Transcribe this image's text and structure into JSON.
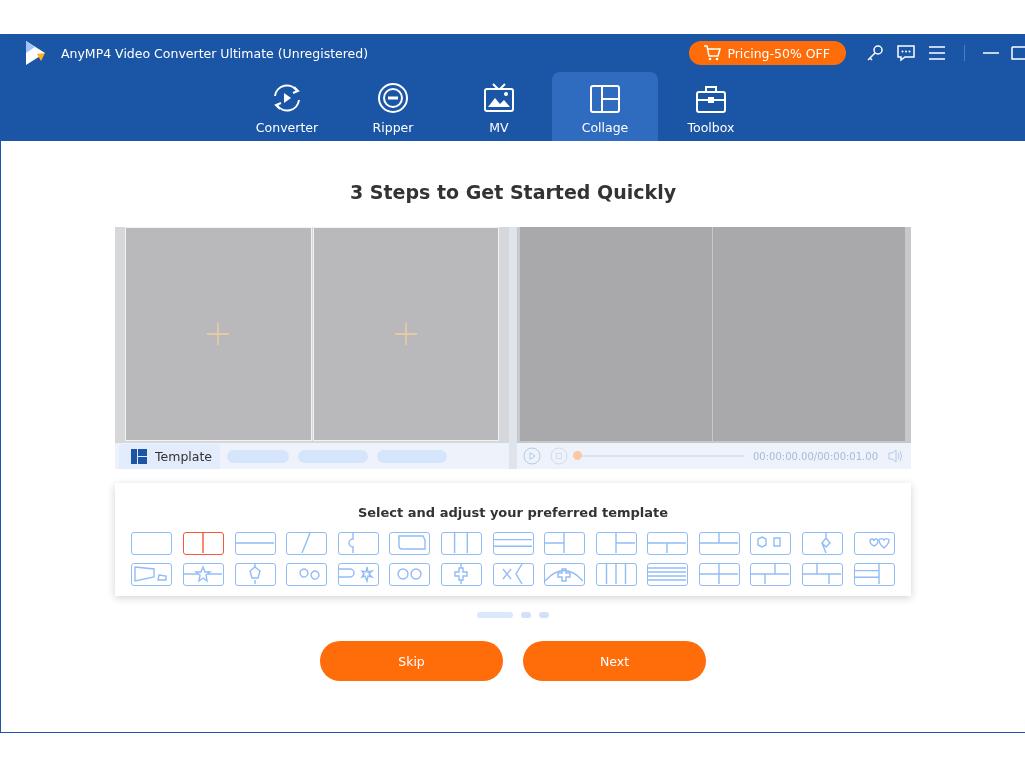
{
  "window": {
    "title": "AnyMP4 Video Converter Ultimate (Unregistered)"
  },
  "promo": {
    "label": "Pricing-50% OFF"
  },
  "tabs": [
    {
      "label": "Converter",
      "kind": "converter",
      "selected": false
    },
    {
      "label": "Ripper",
      "kind": "ripper",
      "selected": false
    },
    {
      "label": "MV",
      "kind": "mv",
      "selected": false
    },
    {
      "label": "Collage",
      "kind": "collage",
      "selected": true
    },
    {
      "label": "Toolbox",
      "kind": "toolbox",
      "selected": false
    }
  ],
  "heading": "3 Steps to Get Started Quickly",
  "preview": {
    "template_tab": {
      "label": "Template"
    },
    "progress": {
      "level": 0
    },
    "time": "00:00:00.00/00:00:01.00"
  },
  "template_panel": {
    "title": "Select and adjust your preferred template",
    "templates": [
      {
        "selected": false
      },
      {
        "selected": true
      },
      {
        "selected": false
      },
      {
        "selected": false
      },
      {
        "selected": false
      },
      {
        "selected": false
      },
      {
        "selected": false
      },
      {
        "selected": false
      },
      {
        "selected": false
      },
      {
        "selected": false
      },
      {
        "selected": false
      },
      {
        "selected": false
      },
      {
        "selected": false
      },
      {
        "selected": false
      },
      {
        "selected": false
      },
      {
        "selected": false
      },
      {
        "selected": false
      },
      {
        "selected": false
      },
      {
        "selected": false
      },
      {
        "selected": false
      },
      {
        "selected": false
      },
      {
        "selected": false
      },
      {
        "selected": false
      },
      {
        "selected": false
      },
      {
        "selected": false
      },
      {
        "selected": false
      },
      {
        "selected": false
      },
      {
        "selected": false
      },
      {
        "selected": false
      },
      {
        "selected": false
      }
    ]
  },
  "pager": [
    {
      "selected": true
    },
    {
      "selected": false
    },
    {
      "selected": false
    }
  ],
  "buttons": [
    {
      "label": "Skip"
    },
    {
      "label": "Next"
    }
  ]
}
